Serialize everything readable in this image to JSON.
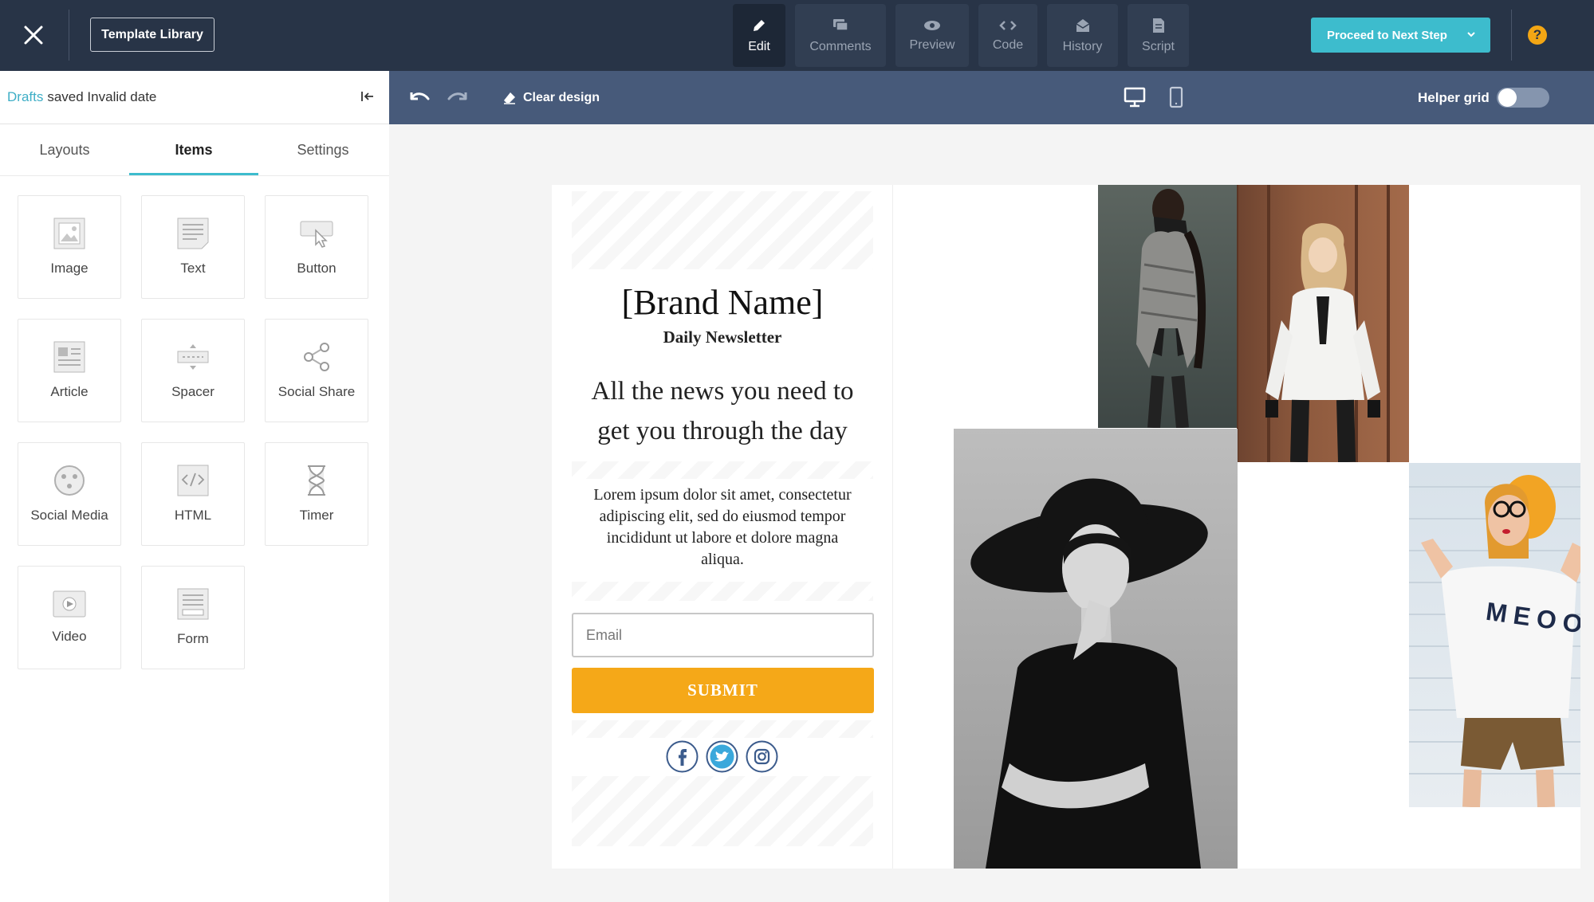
{
  "topbar": {
    "template_library": "Template Library",
    "modes": [
      {
        "label": "Edit",
        "icon": "pencil-icon",
        "active": true
      },
      {
        "label": "Comments",
        "icon": "comments-icon",
        "active": false
      },
      {
        "label": "Preview",
        "icon": "eye-icon",
        "active": false
      },
      {
        "label": "Code",
        "icon": "code-icon",
        "active": false
      },
      {
        "label": "History",
        "icon": "history-icon",
        "active": false
      },
      {
        "label": "Script",
        "icon": "script-icon",
        "active": false
      }
    ],
    "proceed": "Proceed to Next Step",
    "help": "?"
  },
  "panel": {
    "drafts": "Drafts",
    "status": "saved Invalid date",
    "tabs": [
      "Layouts",
      "Items",
      "Settings"
    ],
    "active_tab": "Items",
    "items": [
      "Image",
      "Text",
      "Button",
      "Article",
      "Spacer",
      "Social Share",
      "Social Media",
      "HTML",
      "Timer",
      "Video",
      "Form"
    ]
  },
  "canvasbar": {
    "clear_design": "Clear design",
    "helper_grid": "Helper grid",
    "helper_grid_on": false
  },
  "email": {
    "brand": "[Brand Name]",
    "subtitle": "Daily Newsletter",
    "headline": "All the news you need to get you through the day",
    "body": "Lorem ipsum dolor sit amet, consectetur adipiscing elit, sed do eiusmod tempor incididunt ut labore et dolore magna aliqua.",
    "email_placeholder": "Email",
    "submit": "SUBMIT",
    "shirt_text": "MEOOW"
  },
  "colors": {
    "topbar": "#283447",
    "canvasbar": "#475a7a",
    "accent": "#3dbccd",
    "submit": "#f5a818",
    "help": "#f3a614"
  }
}
